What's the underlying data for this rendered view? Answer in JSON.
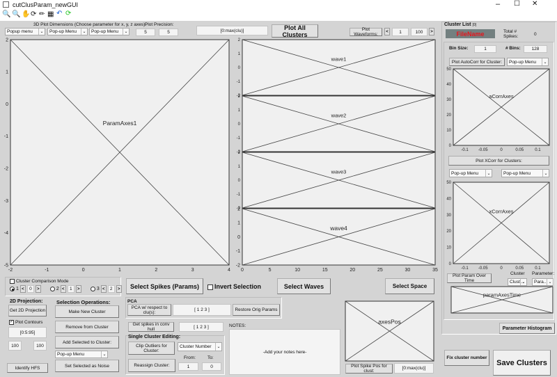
{
  "window": {
    "title": "cutClusParam_newGUI"
  },
  "toolbar": {
    "icons": [
      "zoom-in-icon",
      "zoom-out-icon",
      "pan-icon",
      "rotate-icon",
      "data-cursor-icon",
      "grid-icon",
      "undo-icon",
      "refresh-icon"
    ]
  },
  "top": {
    "dims_label": "3D Plot Dimensions (Choose parameter for x, y, z axes):",
    "popups": [
      "Popup menu",
      "Pop-up Menu",
      "Pop-up Menu"
    ],
    "precision_label": "Plot Precision:",
    "precision": [
      "5",
      "5"
    ],
    "clusters_field": "[0:max(clu)]",
    "plot_all": "Plot All Clusters",
    "plot_waveforms": "Plot Waveforms:",
    "wave_from": "1",
    "wave_to": "100",
    "prev": "<",
    "next": ">"
  },
  "axes": [
    {
      "id": "param",
      "title": "ParamAxes1",
      "xticks": [
        "-2",
        "-1",
        "0",
        "1",
        "2",
        "3",
        "4"
      ],
      "yticks": [
        "2",
        "1",
        "0",
        "-1",
        "-2",
        "-3",
        "-4",
        "-5"
      ]
    },
    {
      "id": "wave1",
      "title": "wave1",
      "xticks": [],
      "yticks": [
        "2",
        "1",
        "0",
        "-1",
        "-2"
      ]
    },
    {
      "id": "wave2",
      "title": "wave2",
      "xticks": [],
      "yticks": [
        "2",
        "1",
        "0",
        "-1",
        "-2"
      ]
    },
    {
      "id": "wave3",
      "title": "wave3",
      "xticks": [],
      "yticks": [
        "2",
        "1",
        "0",
        "-1",
        "-2"
      ]
    },
    {
      "id": "wave4",
      "title": "wave4",
      "xticks": [
        "0",
        "5",
        "10",
        "15",
        "20",
        "25",
        "30",
        "35"
      ],
      "yticks": [
        "2",
        "1",
        "0",
        "-1",
        "-2"
      ]
    },
    {
      "id": "acorr",
      "title": "aCorrAxes",
      "xticks": [
        "-0.1",
        "-0.05",
        "0",
        "0.05",
        "0.1"
      ],
      "yticks": [
        "50",
        "40",
        "30",
        "20",
        "10",
        "0"
      ]
    },
    {
      "id": "xcorr",
      "title": "xCorrAxes",
      "xticks": [
        "-0.1",
        "-0.05",
        "0",
        "0.05",
        "0.1"
      ],
      "yticks": [
        "50",
        "40",
        "30",
        "20",
        "10",
        "0"
      ]
    },
    {
      "id": "time",
      "title": "paramAxesTime",
      "xticks": [],
      "yticks": []
    },
    {
      "id": "pos",
      "title": "axesPos",
      "xticks": [],
      "yticks": []
    }
  ],
  "right": {
    "cluster_list": "Cluster List",
    "cluster_list_count": "[0]",
    "filename": "FileName",
    "filename_color": "#e8141b",
    "total_label": "Total # Spikes:",
    "total": "0",
    "bin_size_label": "Bin Size:",
    "bin_size": "1",
    "bins_label": "# Bins:",
    "bins": "128",
    "plot_autocorr": "Plot AutoCorr for Cluster:",
    "autocorr_popup": "Pop-up Menu",
    "plot_xcorr": "Plot XCorr for Clusters:",
    "xcorr_popups": [
      "Pop-up Menu",
      "Pop-up Menu"
    ],
    "plot_param_time": "Plot Param Over Time",
    "cluster_label": "Cluster",
    "parameter_label": "Parameter:",
    "cluster_popup": "Clust...",
    "param_popup": "Para...",
    "param_hist": "Parameter Histogram",
    "fix_cluster": "Fix cluster number",
    "save": "Save Clusters"
  },
  "bottom": {
    "compare_mode": "Cluster Comparison Mode",
    "radios": [
      {
        "label": "1",
        "value": "0",
        "selected": true
      },
      {
        "label": "2",
        "value": "1",
        "selected": false
      },
      {
        "label": "3",
        "value": "2",
        "selected": false
      }
    ],
    "select_spikes": "Select Spikes (Params)",
    "invert": "Invert Selection",
    "select_waves": "Select Waves",
    "select_space": "Select Space",
    "proj_title": "2D Projection:",
    "get_proj": "Get 2D Projection",
    "plot_contours": "Plot Contours",
    "plot_contours_checked": true,
    "contour_levels": "[0:5:95]",
    "proj_a": "100",
    "proj_b": "100",
    "identify": "Identify HFS",
    "sel_title": "Selection Operations:",
    "make_new": "Make New Cluster",
    "remove": "Remove from Cluster",
    "add_sel": "Add Selected to Cluster:",
    "add_popup": "Pop-up Menu",
    "noise": "Set Selected as Noise",
    "pca_title": "PCA",
    "pca_btn": "PCA w/ respect to clu(s):",
    "pca_field": "[ 1 2 3 ]",
    "restore": "Restore Orig Params",
    "hull_btn": "Get spikes in conv hull",
    "hull_field": "[ 1 2 3 ]",
    "single_title": "Single Cluster Editing:",
    "clip": "Clip Outliers for Cluster:",
    "clip_popup": "Cluster Number",
    "reassign": "Reassign Cluster:",
    "from_label": "From:",
    "to_label": "To:",
    "from": "1",
    "to": "0",
    "notes_label": "NOTES:",
    "notes": "-Add your notes here-",
    "plot_pos": "Plot Spike Pos for clust:",
    "pos_field": "[0:max(clu)]"
  }
}
